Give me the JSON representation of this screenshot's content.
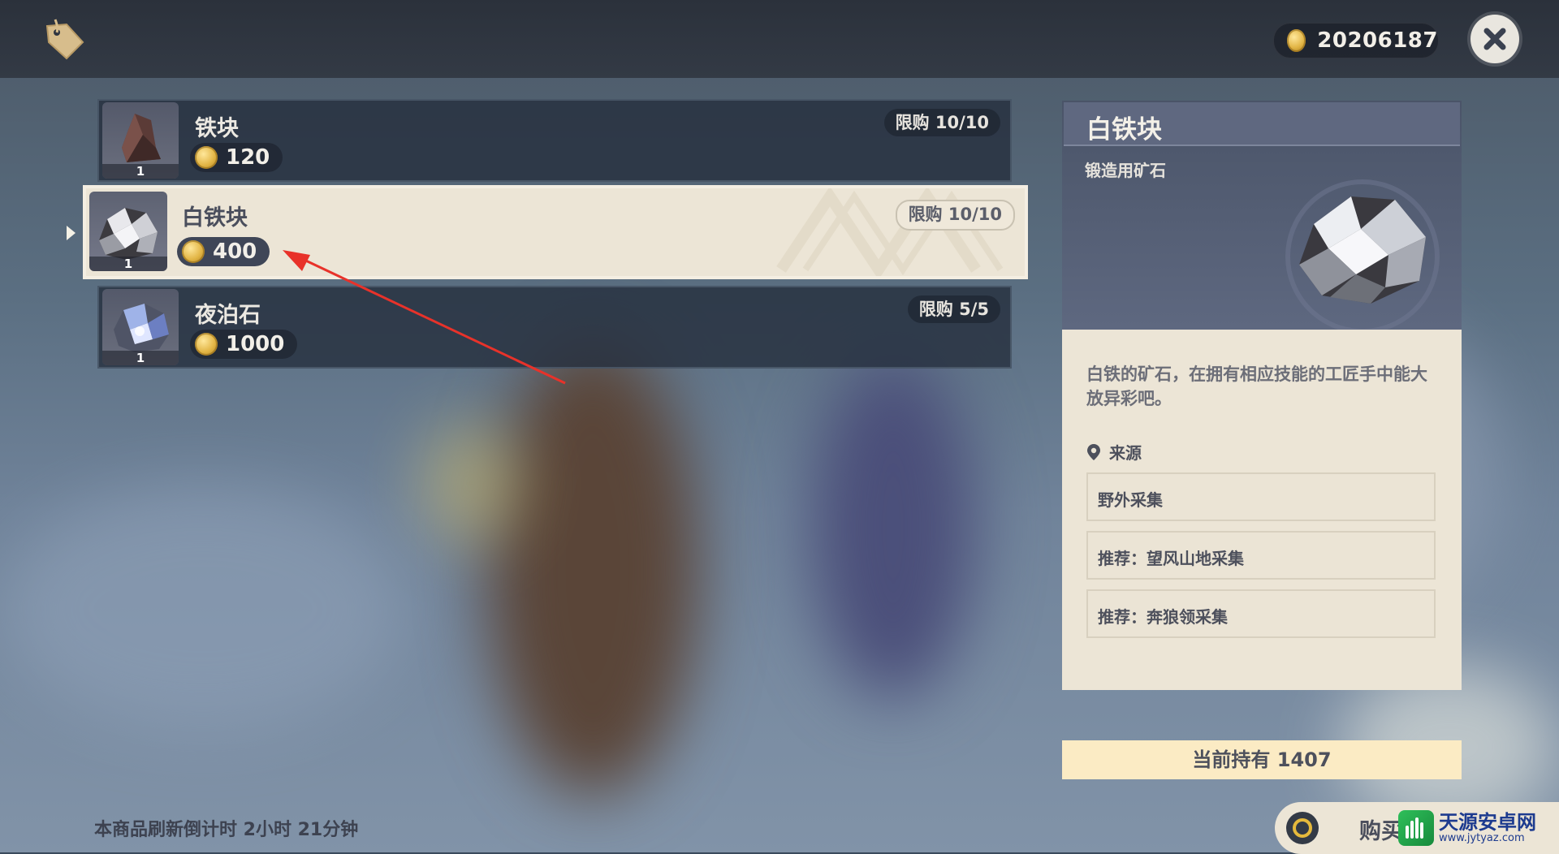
{
  "currency": {
    "value": "20206187",
    "icon": "coin-icon"
  },
  "items": [
    {
      "name": "铁块",
      "price": "120",
      "quantity": "1",
      "limit": "限购 10/10",
      "selected": false,
      "icon": "iron-chunk-icon"
    },
    {
      "name": "白铁块",
      "price": "400",
      "quantity": "1",
      "limit": "限购 10/10",
      "selected": true,
      "icon": "white-iron-chunk-icon"
    },
    {
      "name": "夜泊石",
      "price": "1000",
      "quantity": "1",
      "limit": "限购 5/5",
      "selected": false,
      "icon": "noctilucous-jade-icon"
    }
  ],
  "detail": {
    "title": "白铁块",
    "type": "锻造用矿石",
    "description": "白铁的矿石，在拥有相应技能的工匠手中能大放异彩吧。",
    "source_label": "来源",
    "sources": [
      "野外采集",
      "推荐：望风山地采集",
      "推荐：奔狼领采集"
    ]
  },
  "holding": "当前持有 1407",
  "refresh_text": "本商品刷新倒计时 2小时 21分钟",
  "buy_label": "购买",
  "watermark": {
    "name": "天源安卓网",
    "url": "www.jytyaz.com"
  },
  "colors": {
    "accent_gold": "#e2b545",
    "panel_cream": "#ece5d6",
    "highlight": "#fbebc4",
    "annotation_red": "#e8322a"
  }
}
